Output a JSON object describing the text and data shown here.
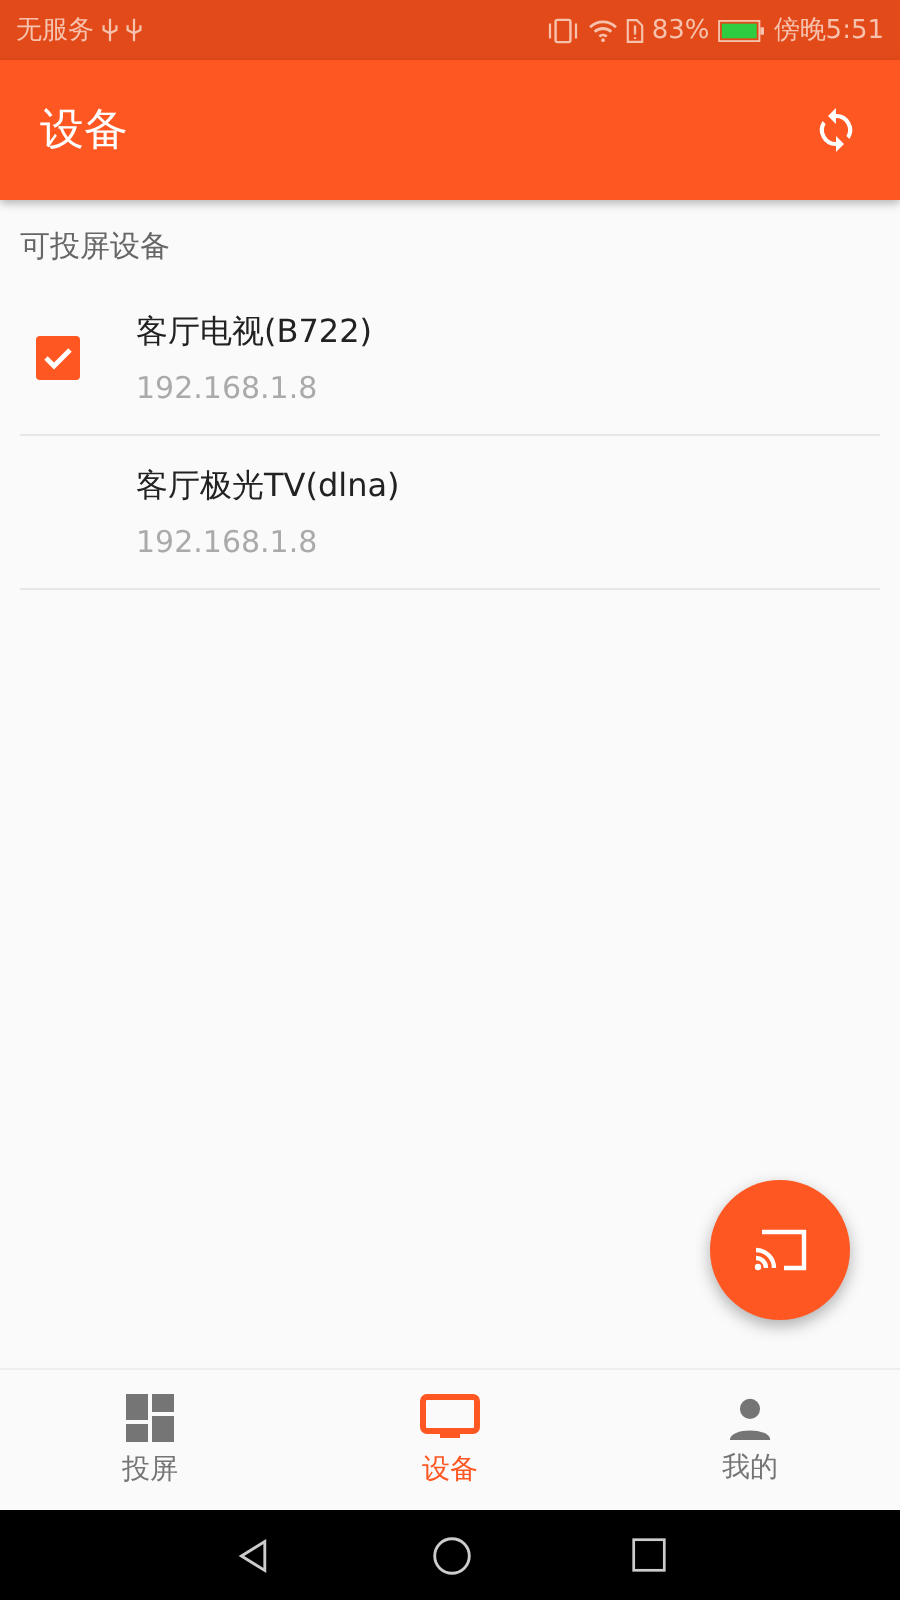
{
  "status_bar": {
    "carrier": "无服务",
    "battery": "83%",
    "time": "傍晚5:51"
  },
  "app_bar": {
    "title": "设备"
  },
  "section": {
    "title": "可投屏设备"
  },
  "devices": [
    {
      "name": "客厅电视(B722)",
      "address": "192.168.1.8",
      "checked": true
    },
    {
      "name": "客厅极光TV(dlna)",
      "address": "192.168.1.8",
      "checked": false
    }
  ],
  "bottom_nav": [
    {
      "label": "投屏",
      "kind": "grid",
      "selected": false
    },
    {
      "label": "设备",
      "kind": "tv",
      "selected": true
    },
    {
      "label": "我的",
      "kind": "person",
      "selected": false
    }
  ]
}
